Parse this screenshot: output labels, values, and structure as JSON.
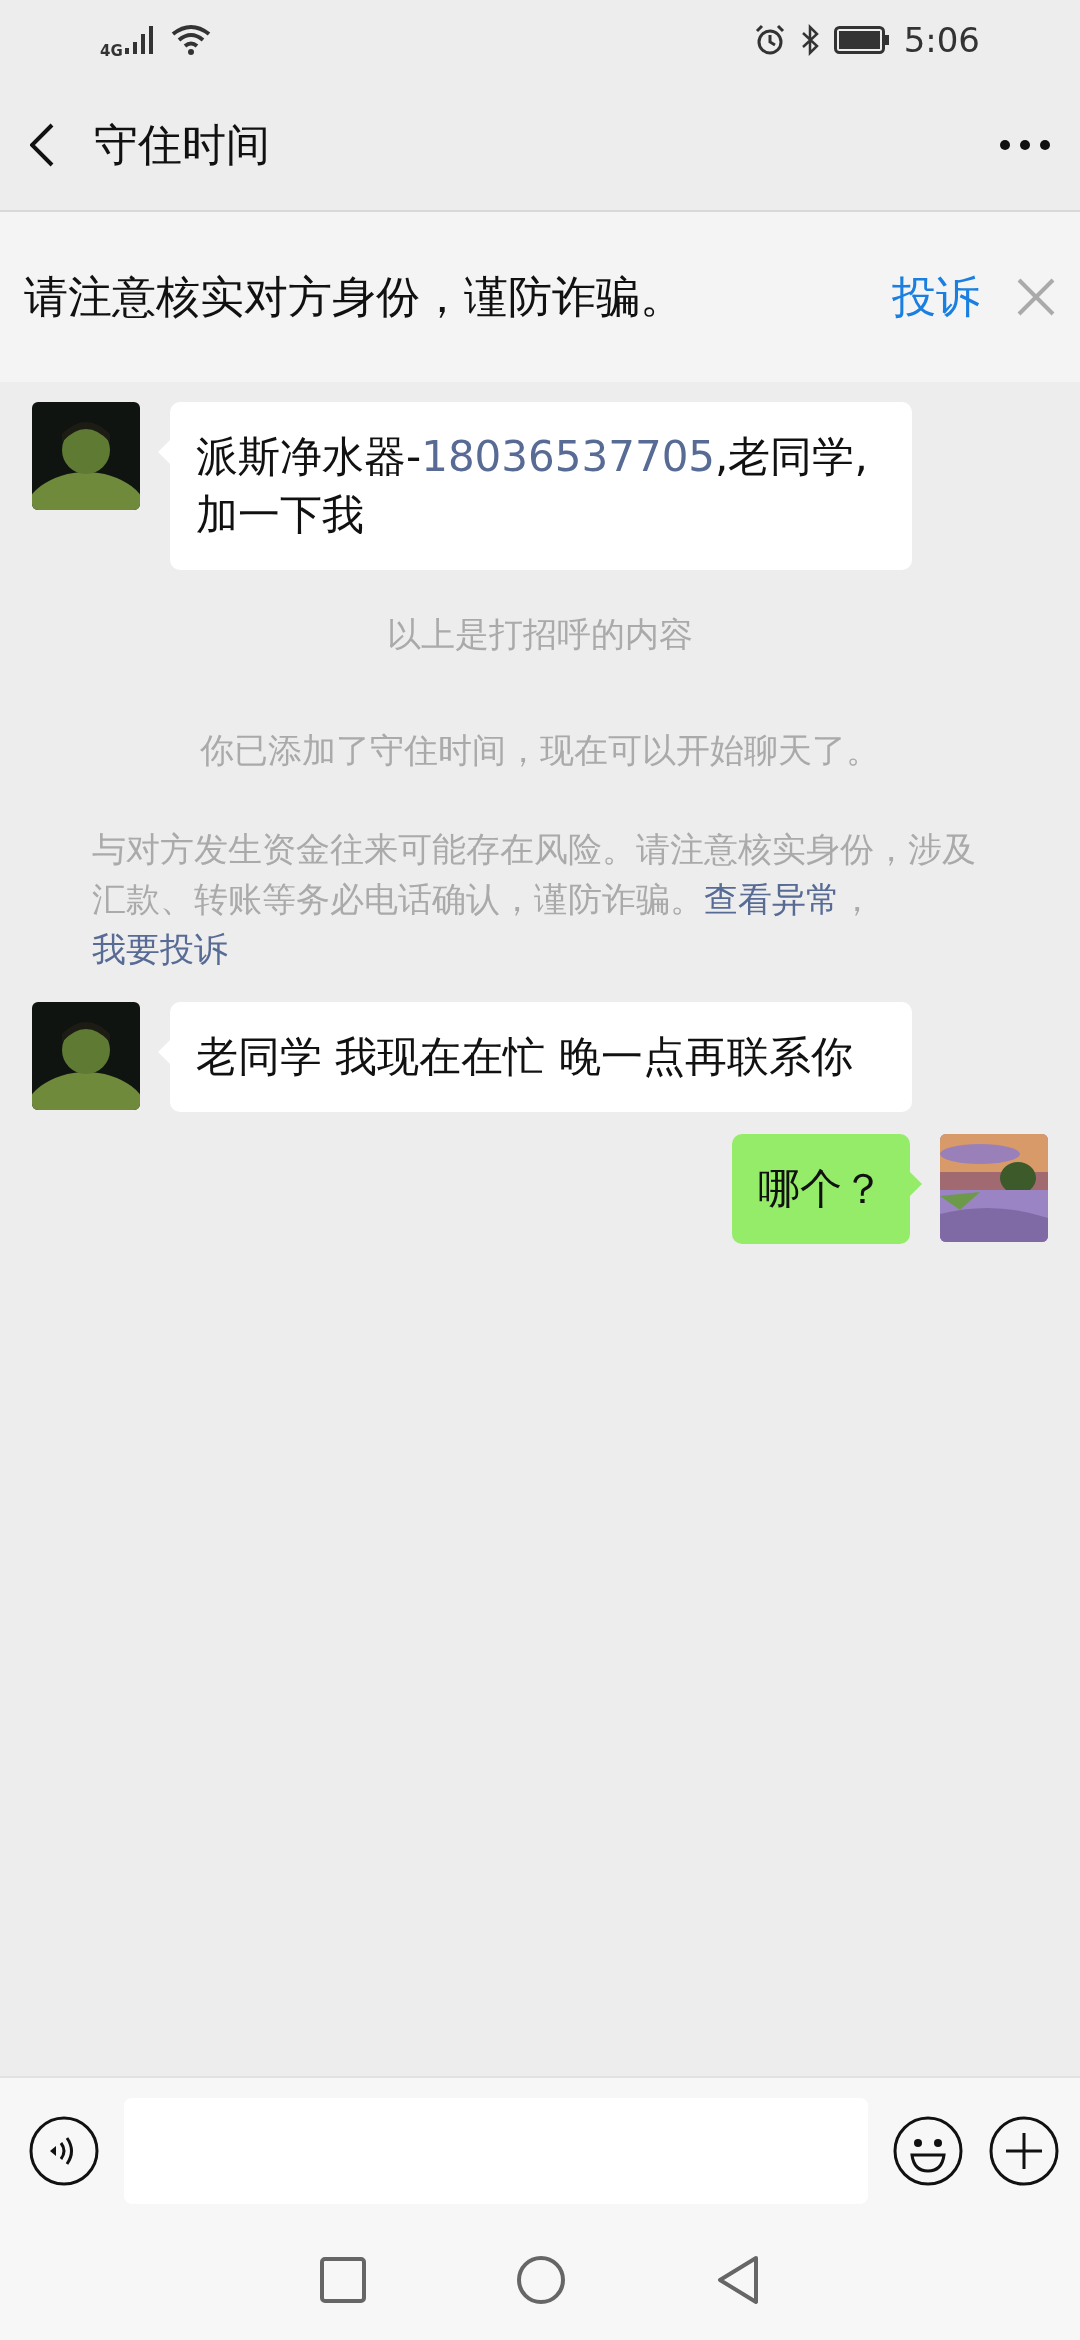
{
  "status_bar": {
    "network": "4G",
    "time": "5:06"
  },
  "header": {
    "title": "守住时间"
  },
  "banner": {
    "text": "请注意核实对方身份，谨防诈骗。",
    "action": "投诉"
  },
  "messages": [
    {
      "kind": "incoming",
      "parts": [
        {
          "kind": "text",
          "text": "派斯净水器-"
        },
        {
          "kind": "link",
          "text": "18036537705"
        },
        {
          "kind": "text",
          "text": ",老同学,加一下我"
        }
      ]
    },
    {
      "kind": "system",
      "text": "以上是打招呼的内容"
    },
    {
      "kind": "system",
      "text": "你已添加了守住时间，现在可以开始聊天了。"
    },
    {
      "kind": "notice",
      "parts": [
        {
          "kind": "text",
          "text": "与对方发生资金往来可能存在风险。请注意核实身份，涉及汇款、转账等务必电话确认，谨防诈骗。"
        },
        {
          "kind": "link",
          "text": "查看异常"
        },
        {
          "kind": "text",
          "text": "，"
        },
        {
          "kind": "link",
          "text": "我要投诉"
        }
      ]
    },
    {
      "kind": "incoming",
      "parts": [
        {
          "kind": "text",
          "text": "老同学  我现在在忙 晚一点再联系你"
        }
      ]
    },
    {
      "kind": "outgoing",
      "parts": [
        {
          "kind": "text",
          "text": "哪个？"
        }
      ]
    }
  ]
}
